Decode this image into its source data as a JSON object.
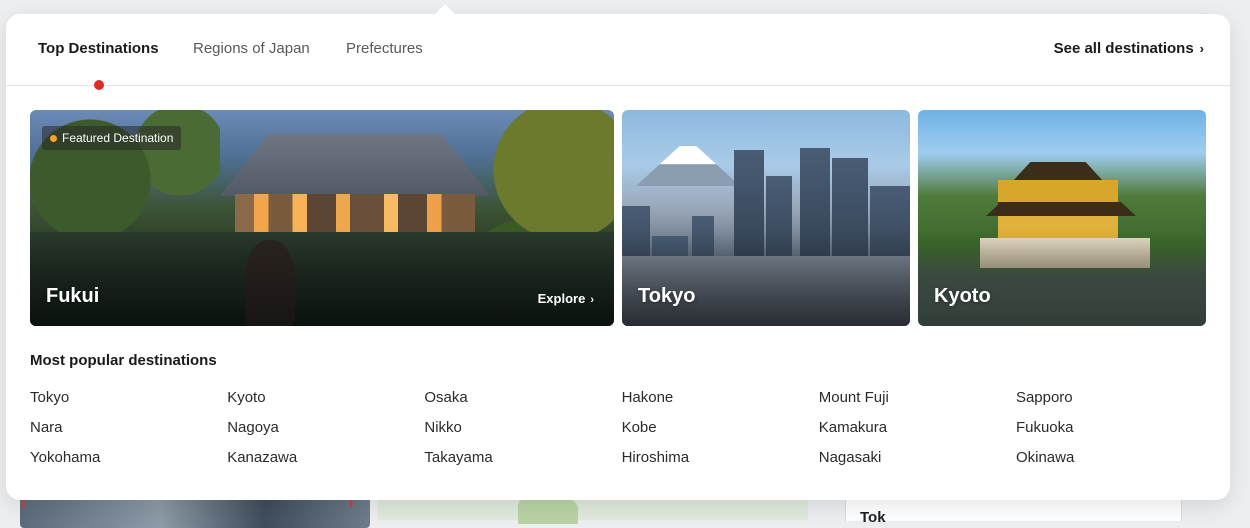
{
  "tabs": [
    {
      "label": "Top Destinations",
      "active": true
    },
    {
      "label": "Regions of Japan",
      "active": false
    },
    {
      "label": "Prefectures",
      "active": false
    }
  ],
  "see_all_label": "See all destinations",
  "featured": {
    "badge": "Featured Destination",
    "name": "Fukui",
    "cta": "Explore"
  },
  "cards": [
    {
      "name": "Tokyo"
    },
    {
      "name": "Kyoto"
    }
  ],
  "popular": {
    "title": "Most popular destinations",
    "items": [
      "Tokyo",
      "Kyoto",
      "Osaka",
      "Hakone",
      "Mount Fuji",
      "Sapporo",
      "Nara",
      "Nagoya",
      "Nikko",
      "Kobe",
      "Kamakura",
      "Fukuoka",
      "Yokohama",
      "Kanazawa",
      "Takayama",
      "Hiroshima",
      "Nagasaki",
      "Okinawa"
    ]
  },
  "background_panel_text": "Tok",
  "colors": {
    "accent": "#e02b2b",
    "badge_dot": "#f5a623",
    "text_primary": "#1a1a1a",
    "text_secondary": "#595959"
  },
  "icons": {
    "see_all": "chevron-right-icon",
    "explore": "chevron-right-icon",
    "carousel_prev": "chevron-left-icon",
    "carousel_next": "chevron-right-icon"
  }
}
